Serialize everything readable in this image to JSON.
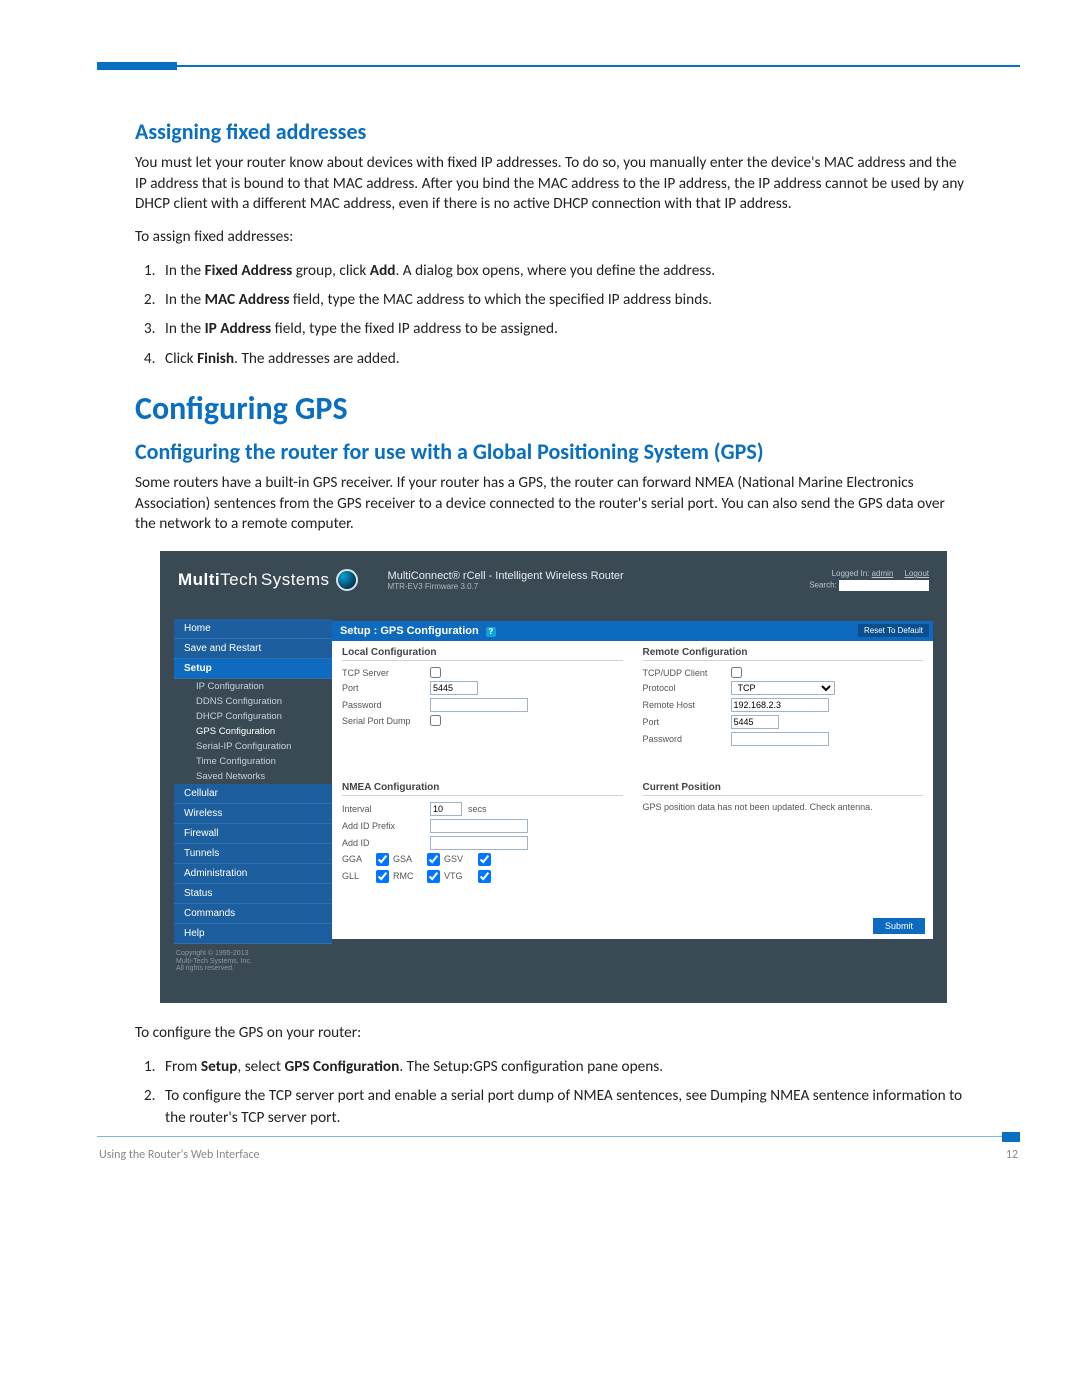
{
  "doc": {
    "h2a": "Assigning fixed addresses",
    "p1": "You must let your router know about devices with fixed IP addresses. To do so, you manually enter the device's MAC address and the IP address that is bound to that MAC address. After you bind the MAC address to the IP address, the IP address cannot be used by any DHCP client with a different MAC address, even if there is no active DHCP connection with that IP address.",
    "p2": "To assign fixed addresses:",
    "steps1": [
      "In the <b>Fixed Address</b> group, click <b>Add</b>. A dialog box opens, where you define the address.",
      "In the <b>MAC Address</b> field, type the MAC address to which the specified IP address binds.",
      "In the <b>IP Address</b> field, type the fixed IP address to be assigned.",
      "Click <b>Finish</b>. The addresses are added."
    ],
    "h1": "Configuring GPS",
    "h2b": "Configuring the router for use with a Global Positioning System (GPS)",
    "p3": "Some routers have a built-in GPS receiver. If your router has a GPS, the router can forward NMEA (National Marine Electronics Association) sentences from the GPS receiver to a device connected to the router's serial port. You can also send the GPS data over the network to a remote computer.",
    "p4": "To configure the GPS on your router:",
    "steps2": [
      "From <b>Setup</b>, select <b>GPS Configuration</b>. The Setup:GPS configuration pane opens.",
      "To configure the TCP server port and enable a serial port dump of NMEA sentences, see Dumping NMEA sentence information to the router's TCP server port."
    ],
    "footer_left": "Using the Router's Web Interface",
    "footer_right": "12"
  },
  "ss": {
    "logo1": "Multi",
    "logo2": "Tech",
    "logo_sub": "Systems",
    "title": "MultiConnect® rCell - Intelligent Wireless Router",
    "firmware": "MTR-EV3  Firmware 3.0.7",
    "logged_in": "Logged In:",
    "user": "admin",
    "logout": "Logout",
    "search_label": "Search:",
    "nav": [
      "Home",
      "Save and Restart",
      "Setup",
      "Cellular",
      "Wireless",
      "Firewall",
      "Tunnels",
      "Administration",
      "Status",
      "Commands",
      "Help"
    ],
    "setup_sub": [
      "IP Configuration",
      "DDNS Configuration",
      "DHCP Configuration",
      "GPS Configuration",
      "Serial-IP Configuration",
      "Time Configuration",
      "Saved Networks"
    ],
    "copyright": "Copyright © 1995-2013\nMulti-Tech Systems, Inc.\nAll rights reserved.",
    "panel_title": "Setup : GPS Configuration",
    "reset": "Reset To Default",
    "local_title": "Local Configuration",
    "local": {
      "tcp_server": "TCP Server",
      "port": "Port",
      "port_val": "5445",
      "password": "Password",
      "serial_dump": "Serial Port Dump"
    },
    "remote_title": "Remote Configuration",
    "remote": {
      "client": "TCP/UDP Client",
      "protocol": "Protocol",
      "protocol_val": "TCP",
      "host": "Remote Host",
      "host_val": "192.168.2.3",
      "port": "Port",
      "port_val": "5445",
      "password": "Password"
    },
    "nmea_title": "NMEA Configuration",
    "nmea": {
      "interval": "Interval",
      "interval_val": "10",
      "secs": "secs",
      "prefix": "Add ID Prefix",
      "addid": "Add ID",
      "row1": [
        "GGA",
        "GSA",
        "GSV"
      ],
      "row2": [
        "GLL",
        "RMC",
        "VTG"
      ]
    },
    "pos_title": "Current Position",
    "pos_msg": "GPS position data has not been updated. Check antenna.",
    "submit": "Submit"
  }
}
